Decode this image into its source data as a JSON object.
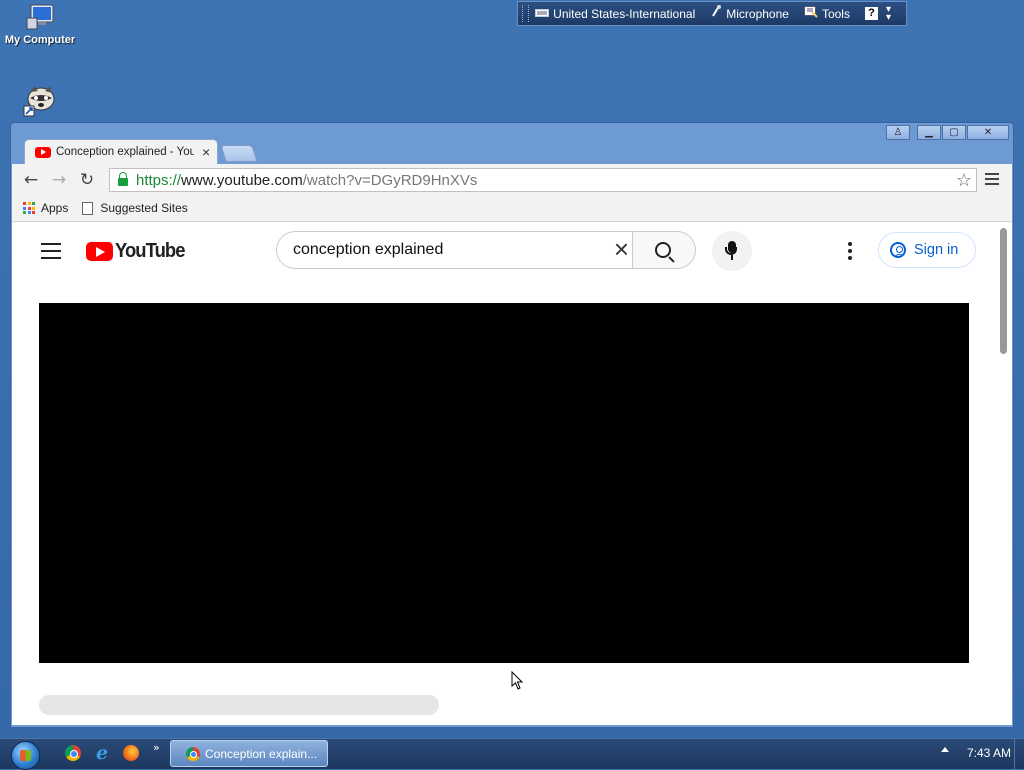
{
  "desktop": {
    "icons": [
      {
        "label": "My Computer",
        "icon": "computer-icon"
      },
      {
        "label": "",
        "icon": "raccoon-shortcut-icon"
      }
    ]
  },
  "language_bar": {
    "language": "United States-International",
    "microphone": "Microphone",
    "tools": "Tools",
    "help": "?"
  },
  "browser": {
    "tab": {
      "title": "Conception explained - YouTube",
      "close": "×"
    },
    "url": {
      "scheme": "https://",
      "host": "www.youtube.com",
      "path": "/watch?v=DGyRD9HnXVs"
    },
    "bookmarks": {
      "apps": "Apps",
      "suggested": "Suggested Sites"
    },
    "window_controls": {
      "profile": "♙",
      "minimize": "▁",
      "maximize": "▢",
      "close": "✕"
    }
  },
  "youtube": {
    "logo_text": "YouTube",
    "search": {
      "value": "conception explained",
      "clear": "×"
    },
    "sign_in": "Sign in",
    "brand_color": "#ff0000",
    "link_color": "#065fd4"
  },
  "taskbar": {
    "quick_launch": [
      "chrome-icon",
      "internet-explorer-icon",
      "firefox-icon"
    ],
    "more": "»",
    "active_task": "Conception explain...",
    "clock": "7:43 AM"
  }
}
